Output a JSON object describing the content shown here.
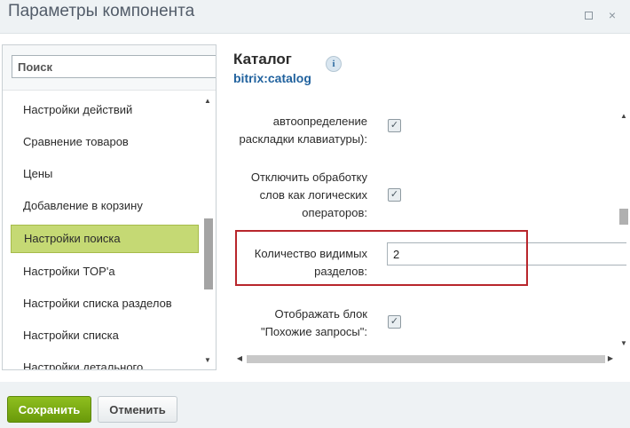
{
  "window": {
    "title": "Параметры компонента"
  },
  "search": {
    "placeholder": "Поиск",
    "value": ""
  },
  "sidebar": {
    "items": [
      {
        "label": "Настройки действий"
      },
      {
        "label": "Сравнение товаров"
      },
      {
        "label": "Цены"
      },
      {
        "label": "Добавление в корзину"
      },
      {
        "label": "Настройки поиска",
        "active": true
      },
      {
        "label": "Настройки TOP'а"
      },
      {
        "label": "Настройки списка разделов"
      },
      {
        "label": "Настройки списка"
      },
      {
        "label": "Настройки детального"
      }
    ]
  },
  "component": {
    "name": "Каталог",
    "code": "bitrix:catalog",
    "info_icon": "i"
  },
  "params": {
    "p1_label_line1": "автоопределение",
    "p1_label_line2": "раскладки клавиатуры):",
    "p1_checked": true,
    "p2_label_line1": "Отключить обработку",
    "p2_label_line2": "слов как логических",
    "p2_label_line3": "операторов:",
    "p2_checked": true,
    "p3_label_line1": "Количество видимых",
    "p3_label_line2": "разделов:",
    "p3_value": "2",
    "p4_label_line1": "Отображать блок",
    "p4_label_line2": "\"Похожие запросы\":",
    "p4_checked": true
  },
  "icons": {
    "check": "✓",
    "close": "×",
    "arrow_up": "▲",
    "arrow_down": "▼",
    "arrow_left": "◀",
    "arrow_right": "▶"
  },
  "footer": {
    "save_label": "Сохранить",
    "cancel_label": "Отменить"
  },
  "colors": {
    "active_item": "#c5d974",
    "save_button": "#7aac14",
    "highlight_border": "#b8262c",
    "link": "#21629e"
  }
}
